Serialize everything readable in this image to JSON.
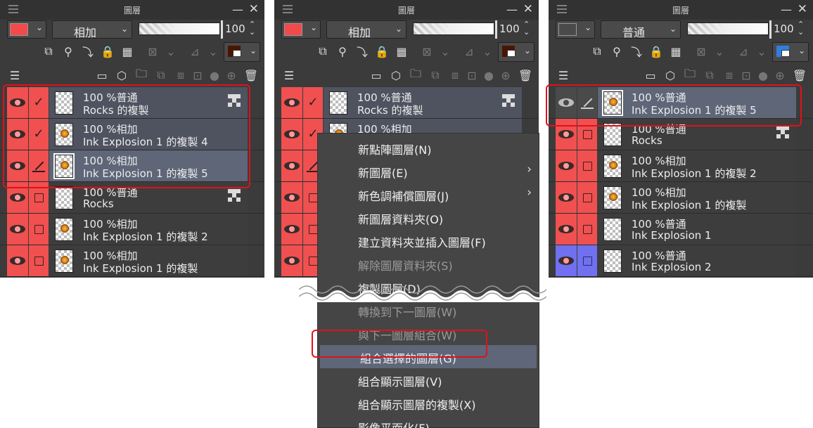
{
  "panel_title": "圖層",
  "panels": [
    {
      "blend_mode": "相加",
      "opacity": "100",
      "swatch_color": "#f24a4a",
      "color_pair": {
        "main": "#4a1500",
        "sub": "#ffffff"
      },
      "layers": [
        {
          "line1": "100 %普通",
          "line2": "Rocks 的複製",
          "state": "half",
          "check": "check",
          "raster": true,
          "thumb": "plain"
        },
        {
          "line1": "100 %相加",
          "line2": "Ink Explosion 1 的複製 4",
          "state": "half",
          "check": "check",
          "raster": false,
          "thumb": "boom"
        },
        {
          "line1": "100 %相加",
          "line2": "Ink Explosion 1 的複製 5",
          "state": "sel",
          "check": "pen",
          "raster": false,
          "thumb": "boom"
        },
        {
          "line1": "100 %普通",
          "line2": "Rocks",
          "state": "normal",
          "check": "box",
          "raster": true,
          "thumb": "plain"
        },
        {
          "line1": "100 %相加",
          "line2": "Ink Explosion 1 的複製 2",
          "state": "normal",
          "check": "box",
          "raster": false,
          "thumb": "boom"
        },
        {
          "line1": "100 %相加",
          "line2": "Ink Explosion 1 的複製",
          "state": "normal",
          "check": "box",
          "raster": false,
          "thumb": "boom"
        }
      ]
    },
    {
      "blend_mode": "相加",
      "opacity": "100",
      "swatch_color": "#f24a4a",
      "color_pair": {
        "main": "#4a1500",
        "sub": "#ffffff"
      },
      "layers": [
        {
          "line1": "100 %普通",
          "line2": "Rocks 的複製",
          "state": "half",
          "check": "check",
          "raster": true,
          "thumb": "plain"
        },
        {
          "line1": "100 %相加",
          "line2": "",
          "state": "half",
          "check": "check",
          "raster": false,
          "thumb": "boom"
        },
        {
          "line1": "",
          "line2": "",
          "state": "normal",
          "check": "pen",
          "raster": false,
          "thumb": "plain"
        },
        {
          "line1": "",
          "line2": "",
          "state": "normal",
          "check": "box",
          "raster": false,
          "thumb": "plain"
        },
        {
          "line1": "",
          "line2": "",
          "state": "normal",
          "check": "box",
          "raster": false,
          "thumb": "plain"
        },
        {
          "line1": "",
          "line2": "",
          "state": "normal",
          "check": "box",
          "raster": false,
          "thumb": "plain"
        }
      ]
    },
    {
      "blend_mode": "普通",
      "opacity": "100",
      "swatch_color": "#4a4a4a",
      "color_pair": {
        "main": "#2f7fe0",
        "sub": "#ffffff"
      },
      "layers": [
        {
          "line1": "100 %普通",
          "line2": "Ink Explosion 1 的複製 5",
          "state": "sel",
          "check": "pen-gray",
          "raster": false,
          "thumb": "boom"
        },
        {
          "line1": "100 %普通",
          "line2": "Rocks",
          "state": "normal",
          "check": "box",
          "raster": true,
          "thumb": "plain"
        },
        {
          "line1": "100 %相加",
          "line2": "Ink Explosion 1 的複製 2",
          "state": "normal",
          "check": "box",
          "raster": false,
          "thumb": "boom"
        },
        {
          "line1": "100 %相加",
          "line2": "Ink Explosion 1 的複製",
          "state": "normal",
          "check": "box",
          "raster": false,
          "thumb": "boom"
        },
        {
          "line1": "100 %普通",
          "line2": "Ink Explosion 1",
          "state": "normal",
          "check": "box",
          "raster": false,
          "thumb": "plain"
        },
        {
          "line1": "100 %普通",
          "line2": "Ink Explosion 2",
          "state": "normal",
          "check": "box-blue",
          "raster": false,
          "thumb": "plain"
        }
      ]
    }
  ],
  "context_menu": {
    "items": [
      {
        "label": "新點陣圖層(N)",
        "state": "normal",
        "submenu": false
      },
      {
        "label": "新圖層(E)",
        "state": "normal",
        "submenu": true
      },
      {
        "label": "新色調補償圖層(J)",
        "state": "normal",
        "submenu": true
      },
      {
        "label": "新圖層資料夾(O)",
        "state": "normal",
        "submenu": false
      },
      {
        "label": "建立資料夾並插入圖層(F)",
        "state": "normal",
        "submenu": false
      },
      {
        "label": "解除圖層資料夾(S)",
        "state": "disabled",
        "submenu": false
      },
      {
        "label": "複製圖層(D)",
        "state": "normal",
        "submenu": false
      },
      {
        "label": "轉換到下一圖層(W)",
        "state": "disabled",
        "submenu": false
      },
      {
        "label": "與下一圖層組合(W)",
        "state": "disabled",
        "submenu": false
      },
      {
        "label": "組合選擇的圖層(G)",
        "state": "highlighted",
        "submenu": false
      },
      {
        "label": "組合顯示圖層(V)",
        "state": "normal",
        "submenu": false
      },
      {
        "label": "組合顯示圖層的複製(X)",
        "state": "normal",
        "submenu": false
      },
      {
        "label": "影像平面化(F)",
        "state": "normal",
        "submenu": false
      }
    ]
  },
  "colors": {
    "panel_bg": "#3b3b3b",
    "visibility_red": "#f05050",
    "visibility_blue": "#7070f0",
    "selection": "#5e6678",
    "callout_red": "#e0111c"
  }
}
